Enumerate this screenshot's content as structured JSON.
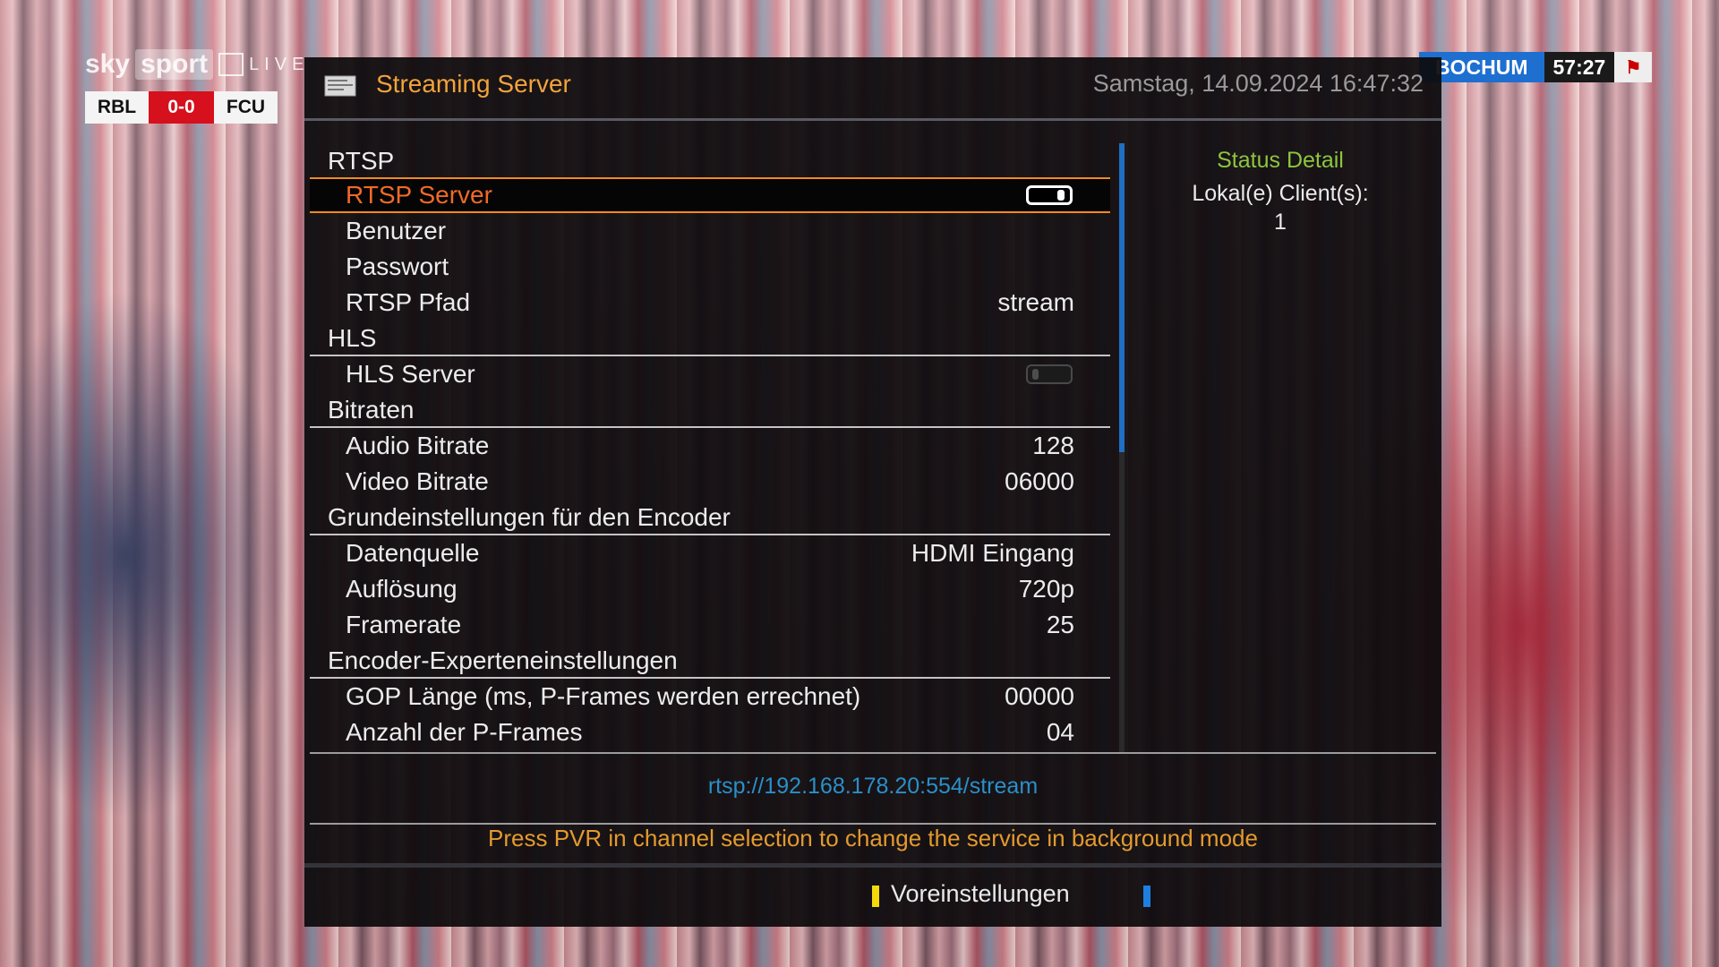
{
  "broadcast": {
    "logo_sky": "sky",
    "logo_sport": "sport",
    "logo_live": "LIVE",
    "home_team": "RBL",
    "score": "0-0",
    "away_team": "FCU",
    "other_team": "BOCHUM",
    "game_clock": "57:27",
    "home_color": "#d6101c",
    "other_color": "#1e6fd0"
  },
  "dialog": {
    "title": "Streaming Server",
    "datetime": "Samstag, 14.09.2024  16:47:32",
    "title_icon": "tv-icon",
    "accent_color": "#f08a22"
  },
  "menu": {
    "rtsp_section": "RTSP",
    "rtsp_server_label": "RTSP Server",
    "rtsp_server_enabled": true,
    "user_label": "Benutzer",
    "user_value": "",
    "password_label": "Passwort",
    "password_value": "",
    "rtsp_path_label": "RTSP Pfad",
    "rtsp_path_value": "stream",
    "hls_section": "HLS",
    "hls_server_label": "HLS Server",
    "hls_server_enabled": false,
    "bitrates_section": "Bitraten",
    "audio_bitrate_label": "Audio Bitrate",
    "audio_bitrate_value": "128",
    "video_bitrate_label": "Video Bitrate",
    "video_bitrate_value": "06000",
    "encoder_section": "Grundeinstellungen für den Encoder",
    "source_label": "Datenquelle",
    "source_value": "HDMI Eingang",
    "resolution_label": "Auflösung",
    "resolution_value": "720p",
    "framerate_label": "Framerate",
    "framerate_value": "25",
    "expert_section": "Encoder-Experteneinstellungen",
    "gop_label": "GOP Länge (ms, P-Frames werden errechnet)",
    "gop_value": "00000",
    "pframes_label": "Anzahl der P-Frames",
    "pframes_value": "04"
  },
  "status": {
    "title": "Status Detail",
    "clients_label": "Lokal(e) Client(s):",
    "clients_value": "1"
  },
  "footer": {
    "stream_url": "rtsp://192.168.178.20:554/stream",
    "hint": "Press PVR in channel selection to change the service in background mode",
    "yellow_button_label": "Voreinstellungen",
    "blue_button_label": ""
  }
}
